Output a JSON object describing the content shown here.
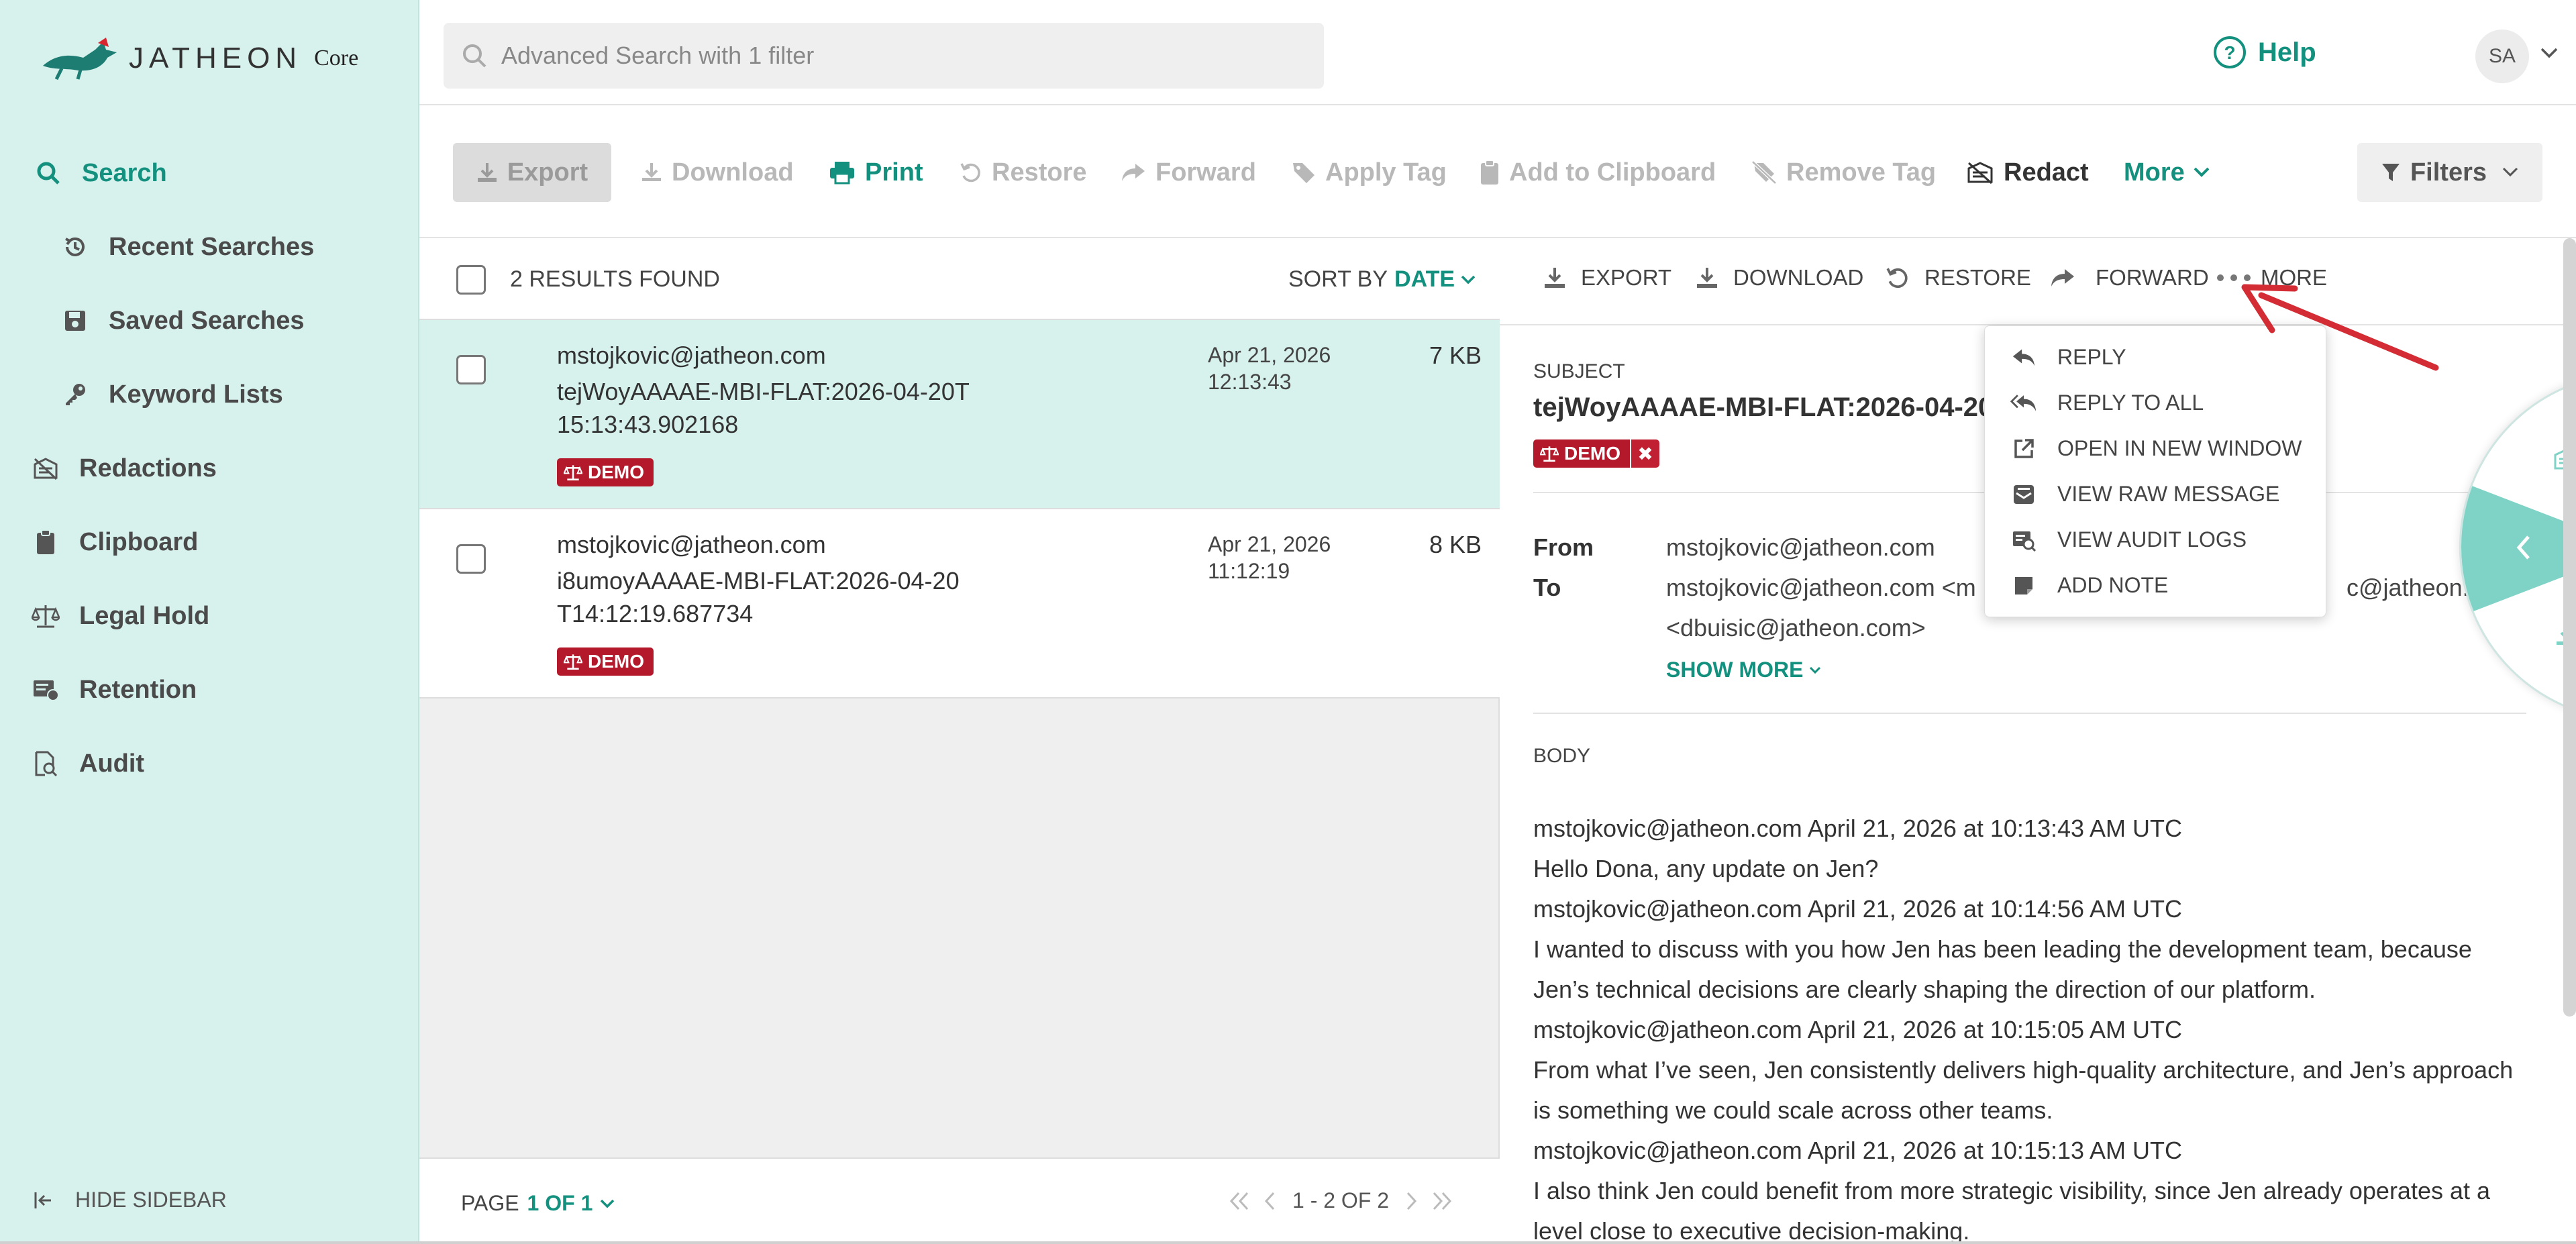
{
  "app": {
    "logo_text": "JATHEON",
    "logo_sub": "Core",
    "accent_color": "#14907f",
    "sidebar_bg": "#d7f1ed",
    "badge_color": "#b3192b"
  },
  "sidebar": {
    "items": [
      {
        "label": "Search",
        "icon": "search-icon"
      },
      {
        "label": "Recent Searches",
        "icon": "history-icon"
      },
      {
        "label": "Saved Searches",
        "icon": "save-icon"
      },
      {
        "label": "Keyword Lists",
        "icon": "key-icon"
      },
      {
        "label": "Redactions",
        "icon": "redact-icon"
      },
      {
        "label": "Clipboard",
        "icon": "clipboard-icon"
      },
      {
        "label": "Legal Hold",
        "icon": "scale-icon"
      },
      {
        "label": "Retention",
        "icon": "retention-icon"
      },
      {
        "label": "Audit",
        "icon": "audit-icon"
      }
    ],
    "hide_label": "HIDE SIDEBAR"
  },
  "topbar": {
    "search_text": "Advanced Search with 1 filter",
    "help_label": "Help",
    "avatar_initials": "SA"
  },
  "toolbar": {
    "export": "Export",
    "download": "Download",
    "print": "Print",
    "restore": "Restore",
    "forward": "Forward",
    "apply_tag": "Apply Tag",
    "add_to_clipboard": "Add to Clipboard",
    "remove_tag": "Remove Tag",
    "redact": "Redact",
    "more": "More",
    "filters": "Filters"
  },
  "results": {
    "count_label": "2 RESULTS FOUND",
    "sort_label": "SORT BY",
    "sort_value": "DATE",
    "rows": [
      {
        "sender": "mstojkovic@jatheon.com",
        "subject": "tejWoyAAAAE-MBI-FLAT:2026-04-20T15:13:43.902168",
        "date_line1": "Apr 21, 2026",
        "date_line2": "12:13:43",
        "size": "7 KB",
        "badge": "DEMO"
      },
      {
        "sender": "mstojkovic@jatheon.com",
        "subject": "i8umoyAAAAE-MBI-FLAT:2026-04-20T14:12:19.687734",
        "date_line1": "Apr 21, 2026",
        "date_line2": "11:12:19",
        "size": "8 KB",
        "badge": "DEMO"
      }
    ],
    "page_label": "PAGE",
    "page_value": "1 OF 1",
    "range": "1 - 2 OF 2"
  },
  "preview": {
    "toolbar": {
      "export": "EXPORT",
      "download": "DOWNLOAD",
      "restore": "RESTORE",
      "forward": "FORWARD",
      "more": "MORE"
    },
    "subject_label": "SUBJECT",
    "subject_value": "tejWoyAAAAE-MBI-FLAT:2026-04-20",
    "badge": "DEMO",
    "from_label": "From",
    "from_value": "mstojkovic@jatheon.com",
    "to_label": "To",
    "to_value_1": "mstojkovic@jatheon.com <m",
    "to_value_1b": "c@jatheon.com",
    "to_value_2": "<dbuisic@jatheon.com>",
    "show_more": "SHOW MORE",
    "body_label": "BODY",
    "body_lines": [
      "mstojkovic@jatheon.com April 21, 2026 at 10:13:43 AM UTC",
      "Hello Dona, any update on Jen?",
      "mstojkovic@jatheon.com April 21, 2026 at 10:14:56 AM UTC",
      "I wanted to discuss with you how Jen has been leading the development team, because",
      "Jen’s technical decisions are clearly shaping the direction of our platform.",
      "mstojkovic@jatheon.com April 21, 2026 at 10:15:05 AM UTC",
      "From what I’ve seen, Jen consistently delivers high-quality architecture, and Jen’s approach",
      "is something we could scale across other teams.",
      "mstojkovic@jatheon.com April 21, 2026 at 10:15:13 AM UTC",
      "I also think Jen could benefit from more strategic visibility, since Jen already operates at a",
      "level close to executive decision-making."
    ]
  },
  "more_menu": {
    "items": [
      {
        "label": "REPLY",
        "icon": "reply-icon"
      },
      {
        "label": "REPLY TO ALL",
        "icon": "reply-all-icon"
      },
      {
        "label": "OPEN IN NEW WINDOW",
        "icon": "external-link-icon"
      },
      {
        "label": "VIEW RAW MESSAGE",
        "icon": "raw-message-icon"
      },
      {
        "label": "VIEW AUDIT LOGS",
        "icon": "audit-log-icon"
      },
      {
        "label": "ADD NOTE",
        "icon": "note-icon"
      }
    ]
  }
}
